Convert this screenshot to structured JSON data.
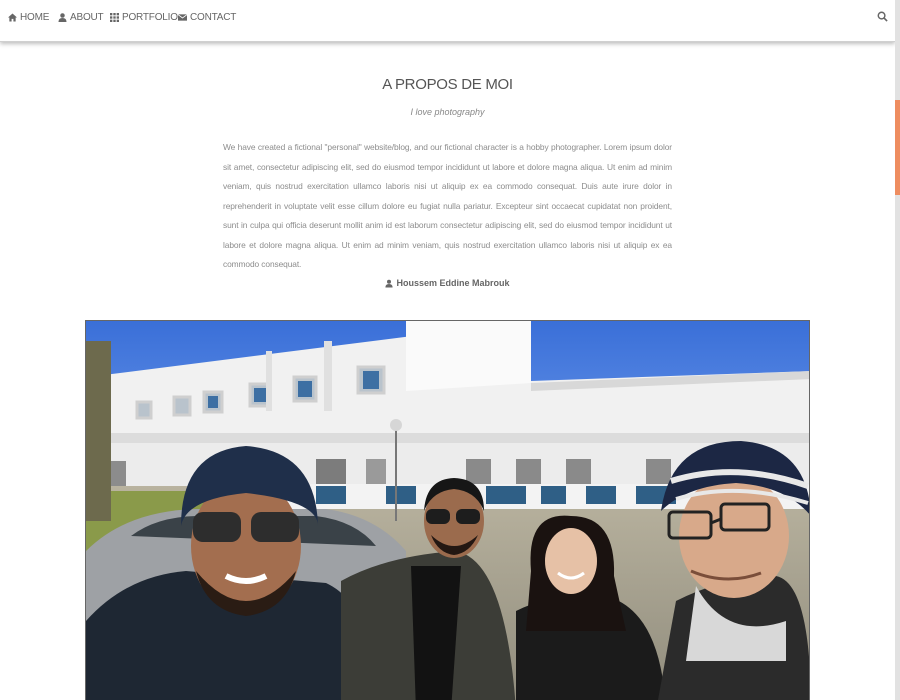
{
  "nav": {
    "home": "HOME",
    "about": "ABOUT",
    "portfolio": "PORTFOLIO",
    "contact": "CONTACT",
    "search_icon": "search-icon"
  },
  "about": {
    "title": "A PROPOS DE MOI",
    "subtitle": "I love photography",
    "bio": "We have created a fictional \"personal\" website/blog, and our fictional character is a hobby photographer. Lorem ipsum dolor sit amet, consectetur adipiscing elit, sed do eiusmod tempor incididunt ut labore et dolore magna aliqua. Ut enim ad minim veniam, quis nostrud exercitation ullamco laboris nisi ut aliquip ex ea commodo consequat. Duis aute irure dolor in reprehenderit in voluptate velit esse cillum dolore eu fugiat nulla pariatur. Excepteur sint occaecat cupidatat non proident, sunt in culpa qui officia deserunt mollit anim id est laborum consectetur adipiscing elit, sed do eiusmod tempor incididunt ut labore et dolore magna aliqua. Ut enim ad minim veniam, quis nostrud exercitation ullamco laboris nisi ut aliquip ex ea commodo consequat.",
    "author": "Houssem Eddine Mabrouk"
  },
  "colors": {
    "scroll_accent": "#ee8d60",
    "text": "#555555"
  }
}
